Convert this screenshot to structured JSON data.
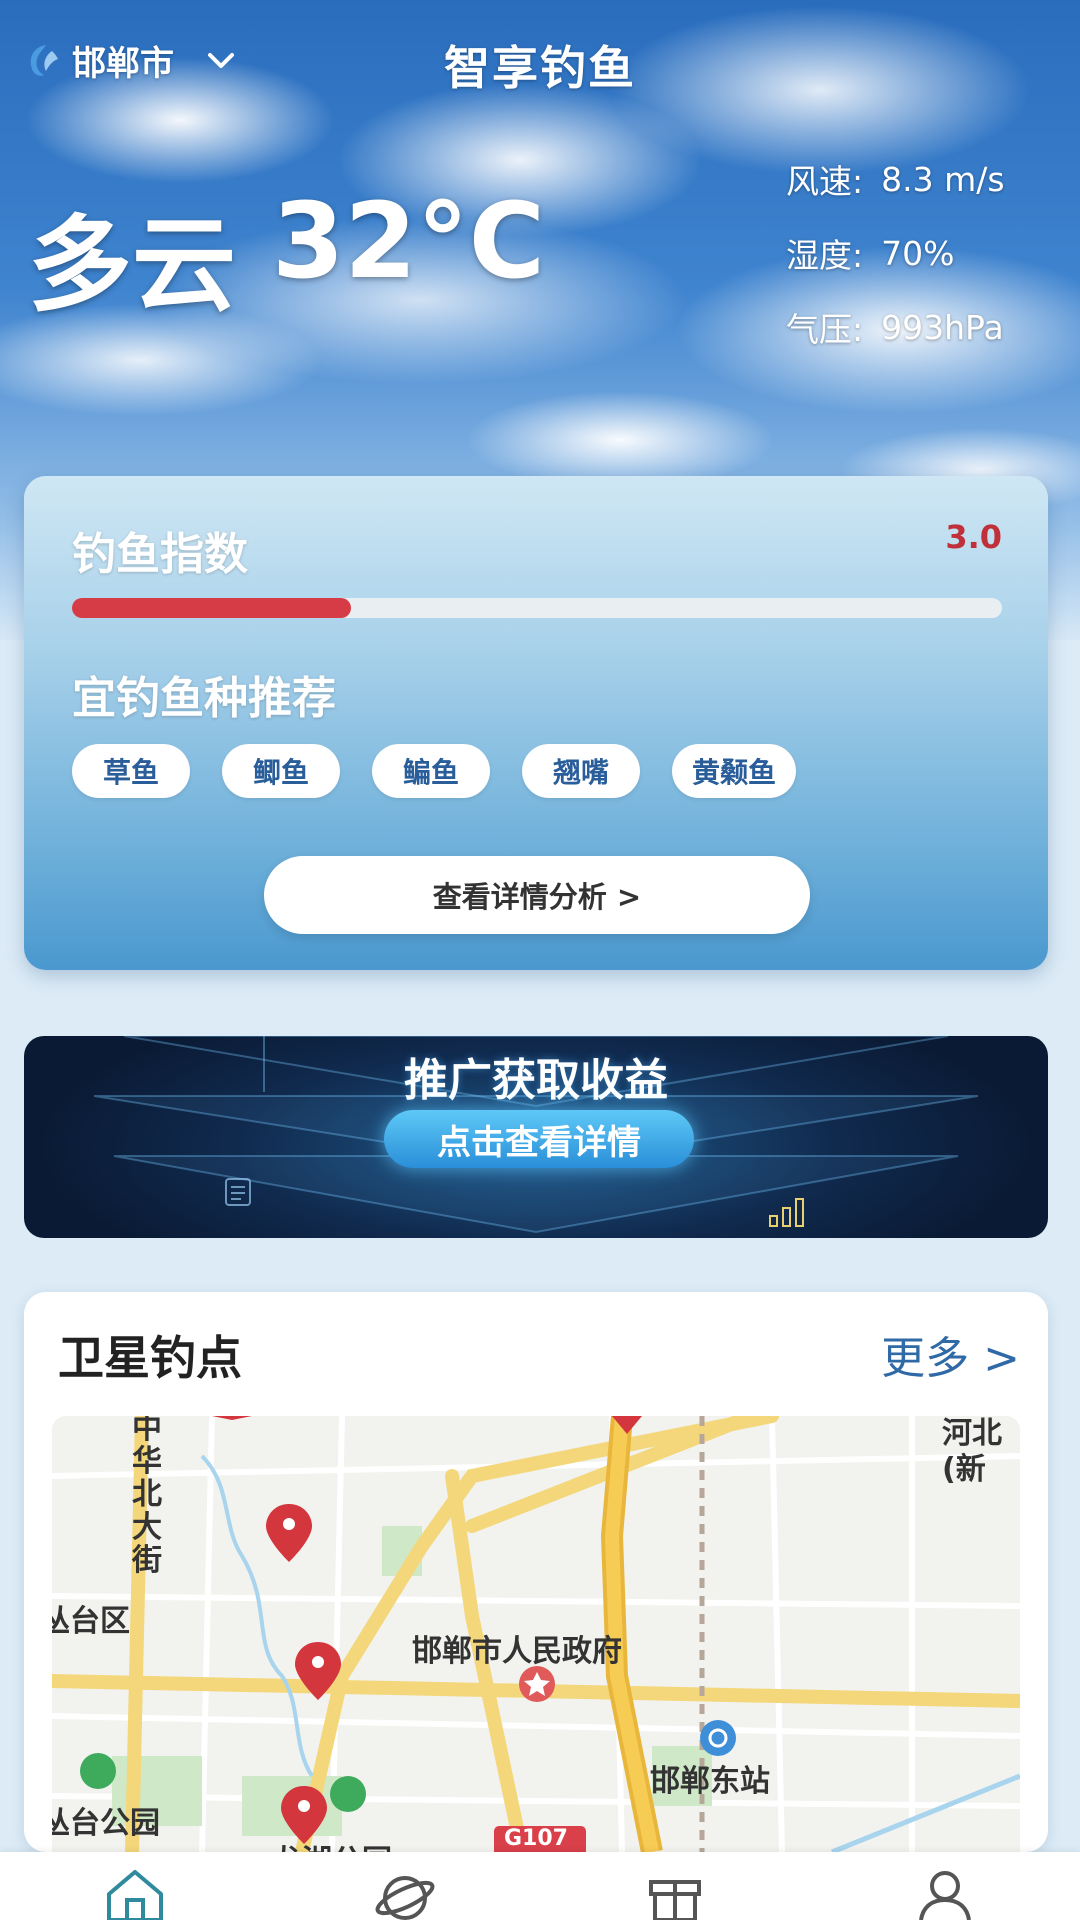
{
  "header": {
    "city": "邯郸市",
    "app_title": "智享钓鱼"
  },
  "weather": {
    "condition": "多云",
    "temperature": "32°C",
    "stats": [
      {
        "label": "风速:",
        "value": "8.3 m/s"
      },
      {
        "label": "湿度:",
        "value": "70%"
      },
      {
        "label": "气压:",
        "value": "993hPa"
      }
    ]
  },
  "fishing_index": {
    "title": "钓鱼指数",
    "score": "3.0",
    "progress_fraction": 0.3,
    "recommend_title": "宜钓鱼种推荐",
    "fish": [
      "草鱼",
      "鲫鱼",
      "鳊鱼",
      "翘嘴",
      "黄颡鱼"
    ],
    "detail_button": "查看详情分析 >"
  },
  "promo": {
    "title": "推广获取收益",
    "button": "点击查看详情"
  },
  "satellite_spots": {
    "title": "卫星钓点",
    "more": "更多 >",
    "map_labels": {
      "street": "中华北大街",
      "district": "丛台区",
      "gov": "邯郸市人民政府",
      "station": "邯郸东站",
      "park1": "丛台公园",
      "park2": "龙湖公园",
      "hebei": "河北(新",
      "road": "G107"
    }
  },
  "tabbar": {
    "icons": [
      "home-icon",
      "planet-icon",
      "gift-icon",
      "user-icon"
    ]
  },
  "colors": {
    "accent_red": "#d63c46",
    "link_blue": "#2f6aa6",
    "tag_text": "#2a5e9a"
  }
}
